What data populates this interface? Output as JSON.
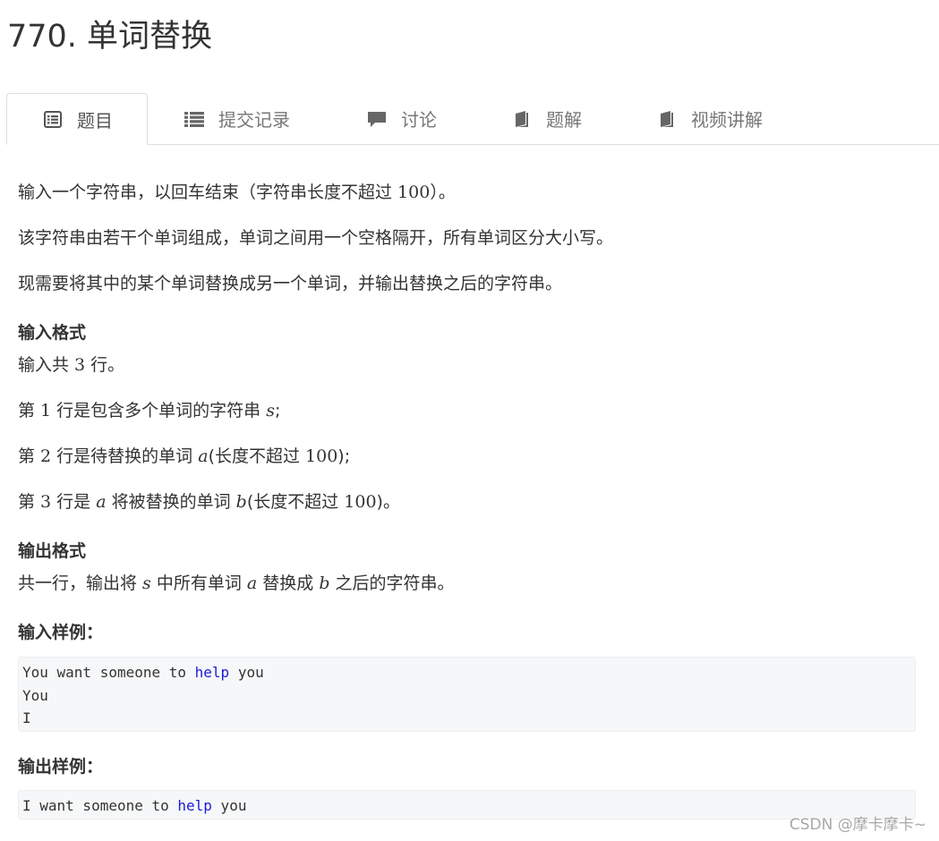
{
  "problem": {
    "title": "770. 单词替换"
  },
  "tabs": [
    {
      "label": "题目",
      "icon": "list-alt-icon",
      "active": true
    },
    {
      "label": "提交记录",
      "icon": "list-icon",
      "active": false
    },
    {
      "label": "讨论",
      "icon": "comment-icon",
      "active": false
    },
    {
      "label": "题解",
      "icon": "book-icon",
      "active": false
    },
    {
      "label": "视频讲解",
      "icon": "book-icon",
      "active": false
    }
  ],
  "description": {
    "p1_pre": "输入一个字符串，以回车结束（字符串长度不超过 ",
    "p1_num": "100",
    "p1_post": "）。",
    "p2": "该字符串由若干个单词组成，单词之间用一个空格隔开，所有单词区分大小写。",
    "p3": "现需要将其中的某个单词替换成另一个单词，并输出替换之后的字符串。"
  },
  "input_format": {
    "heading": "输入格式",
    "l1_pre": "输入共 ",
    "l1_num": "3",
    "l1_post": " 行。",
    "l2_pre": "第 ",
    "l2_num": "1",
    "l2_mid": " 行是包含多个单词的字符串 ",
    "l2_var": "s",
    "l2_post": ";",
    "l3_pre": "第 ",
    "l3_num": "2",
    "l3_mid": " 行是待替换的单词 ",
    "l3_var": "a",
    "l3_mid2": "(长度不超过 ",
    "l3_num2": "100",
    "l3_post": ");",
    "l4_pre": "第 ",
    "l4_num": "3",
    "l4_mid": " 行是 ",
    "l4_var": "a",
    "l4_mid2": " 将被替换的单词 ",
    "l4_var2": "b",
    "l4_mid3": "(长度不超过 ",
    "l4_num2": "100",
    "l4_post": ")。"
  },
  "output_format": {
    "heading": "输出格式",
    "l1_pre": "共一行，输出将 ",
    "l1_var": "s",
    "l1_mid": " 中所有单词 ",
    "l1_var2": "a",
    "l1_mid2": " 替换成 ",
    "l1_var3": "b",
    "l1_post": " 之后的字符串。"
  },
  "sample_input": {
    "heading": "输入样例：",
    "line1_a": "You want someone to ",
    "line1_kw": "help",
    "line1_b": " you",
    "line2": "You",
    "line3": "I"
  },
  "sample_output": {
    "heading": "输出样例：",
    "line1_a": "I want someone to ",
    "line1_kw": "help",
    "line1_b": " you"
  },
  "watermark": "CSDN @摩卡摩卡~"
}
